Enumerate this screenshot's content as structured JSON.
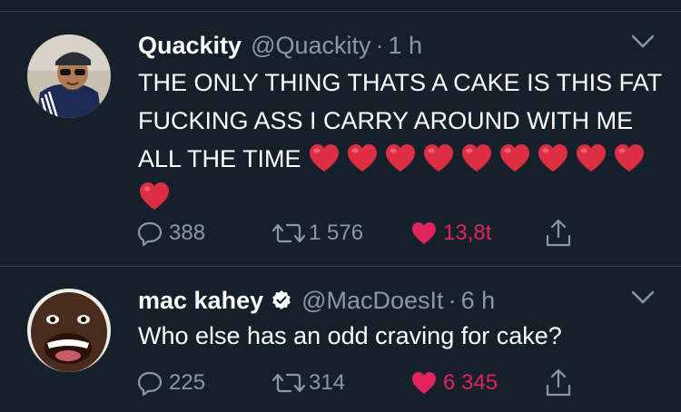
{
  "tweets": [
    {
      "name": "Quackity",
      "handle": "@Quackity",
      "separator": "·",
      "time": "1 h",
      "verified": false,
      "text": "THE ONLY THING THATS A CAKE IS THIS FAT FUCKING ASS I CARRY AROUND WITH ME ALL THE TIME",
      "emoji": "heart",
      "emoji_count": 10,
      "replies": "388",
      "retweets": "1 576",
      "likes": "13,8t",
      "liked": true
    },
    {
      "name": "mac kahey",
      "handle": "@MacDoesIt",
      "separator": "·",
      "time": "6 h",
      "verified": true,
      "text": "Who else has an odd craving for cake?",
      "replies": "225",
      "retweets": "314",
      "likes": "6 345",
      "liked": true
    }
  ],
  "colors": {
    "background": "#15202b",
    "divider": "#38444d",
    "secondary_text": "#8899a6",
    "like": "#e0245e",
    "verified": "#ffffff"
  },
  "icons": [
    "avatar",
    "caret-down-icon",
    "reply-icon",
    "retweet-icon",
    "like-heart-icon",
    "share-icon",
    "verified-badge-icon",
    "red-heart-emoji"
  ]
}
